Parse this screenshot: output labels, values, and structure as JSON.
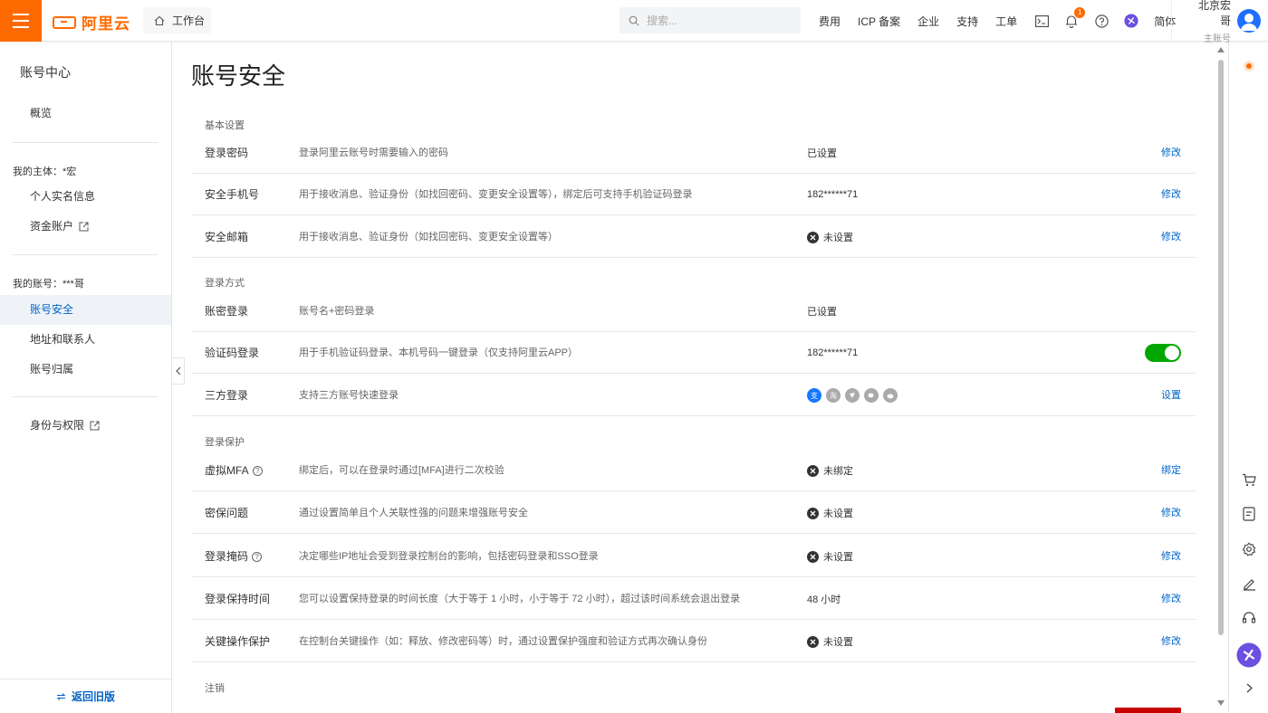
{
  "header": {
    "logo_text": "阿里云",
    "workbench": "工作台",
    "search_placeholder": "搜索...",
    "nav": [
      "费用",
      "ICP 备案",
      "企业",
      "支持",
      "工单"
    ],
    "notification_count": "1",
    "lang": "简体",
    "user_name": "北京宏哥",
    "user_role": "主账号",
    "accent_color": "#ff6a00"
  },
  "sidebar": {
    "title": "账号中心",
    "overview": "概览",
    "entity_group": "我的主体：*宏",
    "entity_items": [
      "个人实名信息",
      "资金账户"
    ],
    "account_group": "我的账号：***哥",
    "account_items": [
      "账号安全",
      "地址和联系人",
      "账号归属"
    ],
    "identity": "身份与权限",
    "footer": "返回旧版"
  },
  "main": {
    "page_title": "账号安全",
    "sections": {
      "basic": "基本设置",
      "login_method": "登录方式",
      "login_protect": "登录保护",
      "cancel": "注销"
    },
    "rows": [
      {
        "label": "登录密码",
        "desc": "登录阿里云账号时需要输入的密码",
        "status": "已设置",
        "action": "修改"
      },
      {
        "label": "安全手机号",
        "desc": "用于接收消息、验证身份（如找回密码、变更安全设置等），绑定后可支持手机验证码登录",
        "status": "182******71",
        "action": "修改"
      },
      {
        "label": "安全邮箱",
        "desc": "用于接收消息、验证身份（如找回密码、变更安全设置等）",
        "status": "未设置",
        "action": "修改"
      },
      {
        "label": "账密登录",
        "desc": "账号名+密码登录",
        "status": "已设置",
        "action": ""
      },
      {
        "label": "验证码登录",
        "desc": "用于手机验证码登录、本机号码一键登录（仅支持阿里云APP）",
        "status": "182******71",
        "action": ""
      },
      {
        "label": "三方登录",
        "desc": "支持三方账号快速登录",
        "status": "",
        "action": "设置"
      },
      {
        "label": "虚拟MFA",
        "desc": "绑定后，可以在登录时通过[MFA]进行二次校验",
        "status": "未绑定",
        "action": "绑定"
      },
      {
        "label": "密保问题",
        "desc": "通过设置简单且个人关联性强的问题来增强账号安全",
        "status": "未设置",
        "action": "修改"
      },
      {
        "label": "登录掩码",
        "desc": "决定哪些IP地址会受到登录控制台的影响，包括密码登录和SSO登录",
        "status": "未设置",
        "action": "修改"
      },
      {
        "label": "登录保持时间",
        "desc": "您可以设置保持登录的时间长度（大于等于 1 小时，小于等于 72 小时），超过该时间系统会退出登录",
        "status": "48 小时",
        "action": "修改"
      },
      {
        "label": "关键操作保护",
        "desc": "在控制台关键操作（如：释放、修改密码等）时，通过设置保护强度和验证方式再次确认身份",
        "status": "未设置",
        "action": "修改"
      }
    ],
    "verify_toggle_on": true,
    "toggle_color": "#00a700",
    "link_color": "#0064c8"
  }
}
